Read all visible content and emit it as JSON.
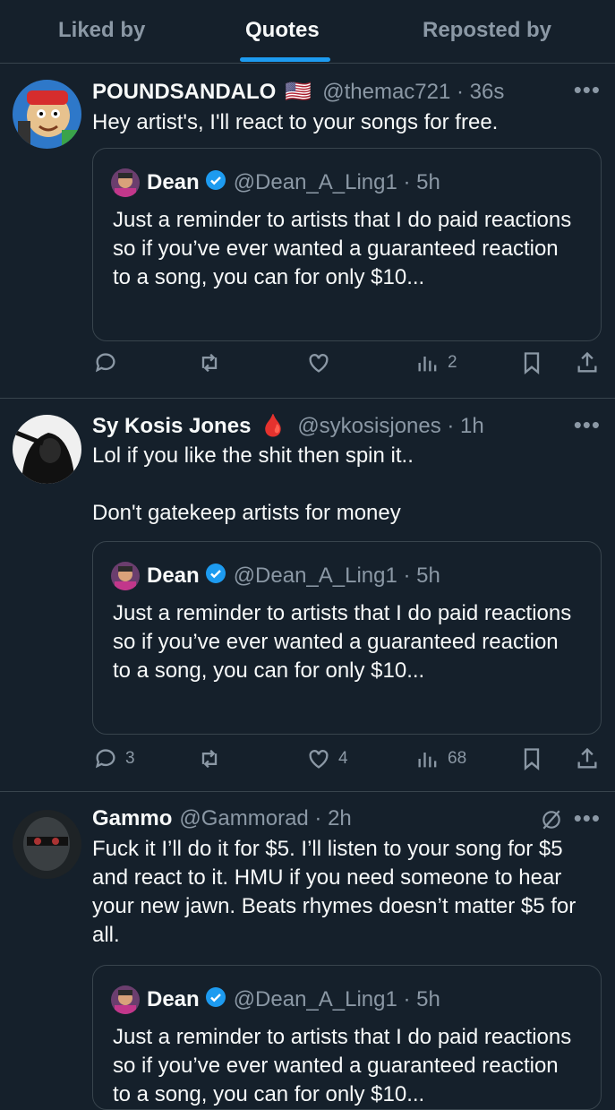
{
  "tabs": [
    {
      "label": "Liked by"
    },
    {
      "label": "Quotes"
    },
    {
      "label": "Reposted by"
    }
  ],
  "quoted": {
    "name": "Dean",
    "handle_time": "@Dean_A_Ling1 · 5h",
    "text": "Just a reminder to artists that I do paid reactions so if you’ve ever wanted a guaranteed reaction to a song, you can for only $10..."
  },
  "tweets": [
    {
      "name": "POUNDSANDALO",
      "emoji": "🇺🇸",
      "handle_time": "@themac721 · 36s",
      "text": "Hey artist's, I'll react to your songs for free.",
      "replies": "",
      "likes": "",
      "views": "2"
    },
    {
      "name": "Sy Kosis Jones",
      "emoji": "🩸",
      "handle_time": "@sykosisjones · 1h",
      "text": "Lol if you like the shit then spin it..\n\nDon't gatekeep artists for money",
      "replies": "3",
      "likes": "4",
      "views": "68"
    },
    {
      "name": "Gammo",
      "handle_time": "@Gammorad · 2h",
      "text": "Fuck it I’ll do it for $5. I’ll listen to your song for $5 and react to it. HMU if you need someone to hear your new jawn. Beats rhymes doesn’t matter $5 for all."
    }
  ],
  "colors": {
    "background": "#15202b",
    "accent": "#1d9bf0",
    "muted": "#8b98a5",
    "border": "#38444d"
  }
}
